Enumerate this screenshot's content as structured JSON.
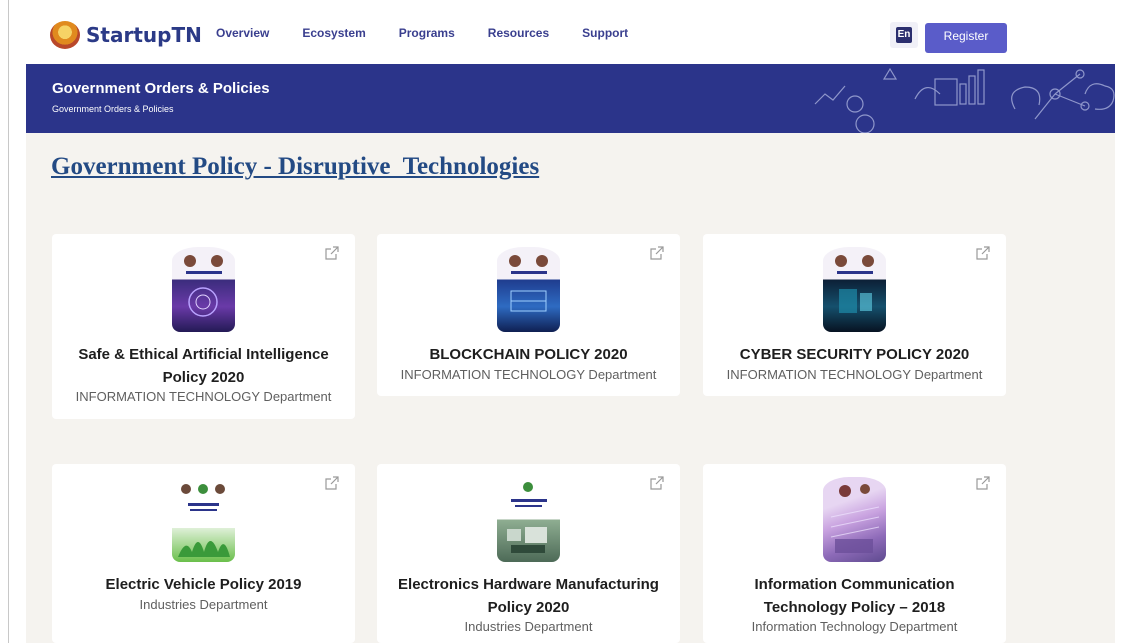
{
  "header": {
    "logo_text": "StartupTN",
    "nav": [
      "Overview",
      "Ecosystem",
      "Programs",
      "Resources",
      "Support"
    ],
    "lang_label": "En",
    "register_label": "Register"
  },
  "banner": {
    "title": "Government Orders & Policies",
    "breadcrumb": "Government Orders & Policies"
  },
  "page_heading": "Government Policy - Disruptive  Technologies",
  "policies": [
    {
      "title": "Safe & Ethical Artificial Intelligence Policy 2020",
      "department": "INFORMATION TECHNOLOGY Department"
    },
    {
      "title": "BLOCKCHAIN POLICY 2020",
      "department": "INFORMATION TECHNOLOGY Department"
    },
    {
      "title": "CYBER SECURITY POLICY 2020",
      "department": "INFORMATION TECHNOLOGY Department"
    },
    {
      "title": "Electric Vehicle Policy 2019",
      "department": "Industries Department"
    },
    {
      "title": "Electronics Hardware Manufacturing Policy 2020",
      "department": "Industries Department"
    },
    {
      "title": "Information Communication Technology Policy – 2018",
      "department": "Information Technology Department"
    }
  ],
  "colors": {
    "brand": "#2b348a",
    "accent": "#5a5cc9",
    "heading": "#234a84",
    "background": "#f5f3ef"
  }
}
